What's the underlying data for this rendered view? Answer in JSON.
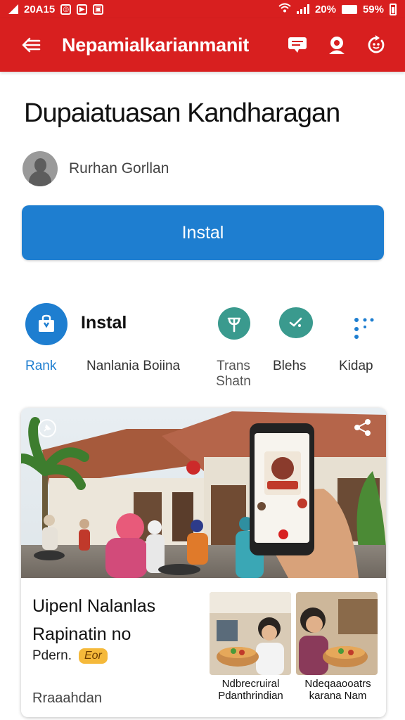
{
  "status_bar": {
    "time": "20A15",
    "signal_text": "20%",
    "battery": "59%"
  },
  "app_bar": {
    "title": "Nepamialkarianmanit",
    "back_icon": "back-arrow-icon",
    "actions": [
      "chat-icon",
      "search-icon",
      "refresh-icon"
    ]
  },
  "header": {
    "title": "Dupaiatuasan Kandharagan",
    "author": "Rurhan Gorllan"
  },
  "install_button": {
    "label": "Instal"
  },
  "actions_row": {
    "primary_inline_label": "Instal",
    "items": [
      {
        "label": "Rank",
        "icon": "bag-icon",
        "color": "#1e7ed0"
      },
      {
        "label": "Nanlania Boiina",
        "icon": "none"
      },
      {
        "label": "Trans Shatn",
        "icon": "fork-icon",
        "color": "#3a9a8e"
      },
      {
        "label": "Blehs",
        "icon": "chat-check-icon",
        "color": "#3a9a8e"
      },
      {
        "label": "Kidap",
        "icon": "dots-icon",
        "color": "#1e7ed0"
      }
    ]
  },
  "card": {
    "hero_icons": [
      "pin-icon",
      "share-icon"
    ],
    "title": "Uipenl Nalanlas Rapinatin no",
    "meta_text": "Pdern.",
    "meta_badge": "Eor",
    "footer": "Rraaahdan",
    "thumbs": [
      {
        "caption": "Ndbrecruiral Pdanthrindian"
      },
      {
        "caption": "Ndeqaaooatrs karana Nam"
      }
    ]
  },
  "colors": {
    "brand_red": "#d81f1f",
    "primary_blue": "#1e7ed0",
    "teal": "#3a9a8e"
  }
}
